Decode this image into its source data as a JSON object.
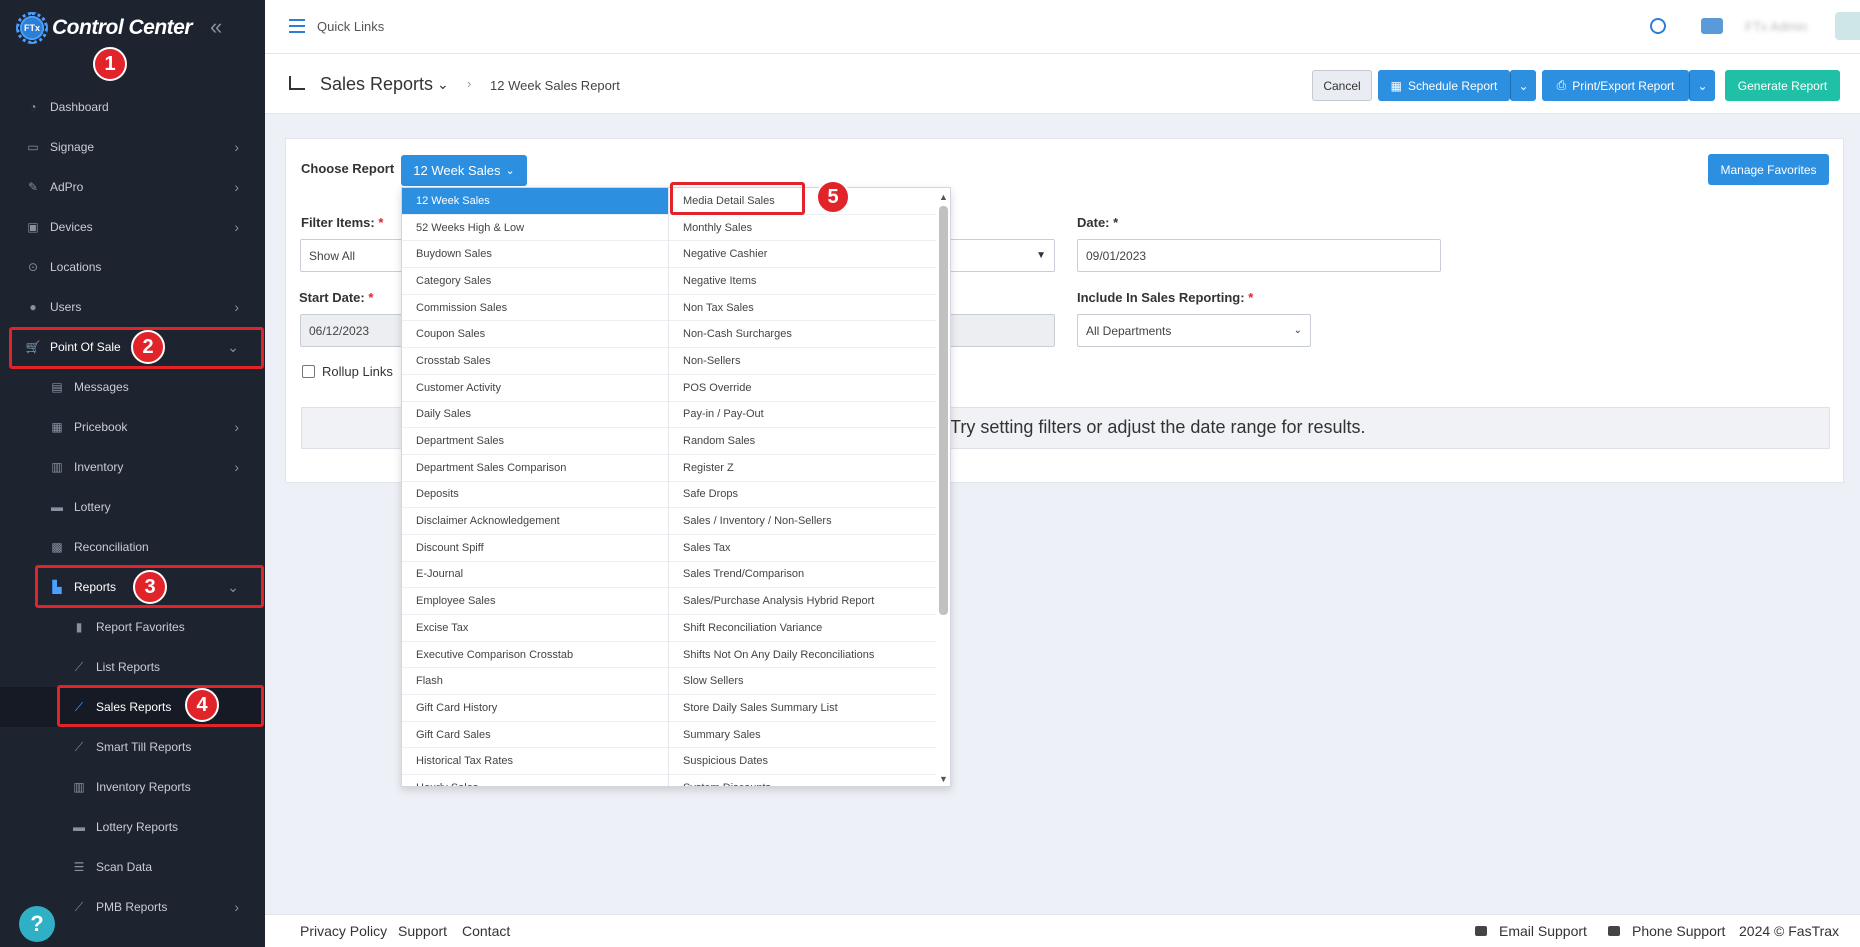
{
  "app": {
    "title": "Control Center",
    "logo_badge": "FTx"
  },
  "sidebar": {
    "items": [
      {
        "label": "Dashboard",
        "icon": "dashboard-icon"
      },
      {
        "label": "Signage",
        "icon": "monitor-icon"
      },
      {
        "label": "AdPro",
        "icon": "brush-icon"
      },
      {
        "label": "Devices",
        "icon": "devices-icon"
      },
      {
        "label": "Locations",
        "icon": "location-pin-icon"
      },
      {
        "label": "Users",
        "icon": "users-icon"
      },
      {
        "label": "Point Of Sale",
        "icon": "cart-icon"
      },
      {
        "label": "Messages",
        "icon": "message-icon"
      },
      {
        "label": "Pricebook",
        "icon": "calculator-icon"
      },
      {
        "label": "Inventory",
        "icon": "inventory-icon"
      },
      {
        "label": "Lottery",
        "icon": "ticket-icon"
      },
      {
        "label": "Reconciliation",
        "icon": "grid-icon"
      },
      {
        "label": "Reports",
        "icon": "bar-chart-icon"
      },
      {
        "label": "Report Favorites",
        "icon": "bookmark-icon"
      },
      {
        "label": "List Reports",
        "icon": "line-chart-icon"
      },
      {
        "label": "Sales Reports",
        "icon": "line-chart-icon"
      },
      {
        "label": "Smart Till Reports",
        "icon": "line-chart-icon"
      },
      {
        "label": "Inventory Reports",
        "icon": "inventory-icon"
      },
      {
        "label": "Lottery Reports",
        "icon": "ticket-icon"
      },
      {
        "label": "Scan Data",
        "icon": "list-icon"
      },
      {
        "label": "PMB Reports",
        "icon": "line-chart-icon"
      }
    ]
  },
  "annotations": [
    "1",
    "2",
    "3",
    "4",
    "5"
  ],
  "topbar": {
    "quick_links": "Quick Links",
    "user_name": "FTx Admin"
  },
  "header": {
    "title": "Sales Reports",
    "breadcrumb": "12 Week Sales Report",
    "cancel": "Cancel",
    "schedule": "Schedule Report",
    "print_export": "Print/Export Report",
    "generate": "Generate Report"
  },
  "form": {
    "choose_report_label": "Choose Report",
    "choose_report_value": "12 Week Sales",
    "manage_favorites": "Manage Favorites",
    "filter_items_label": "Filter Items:",
    "filter_items_value": "Show All",
    "date_label": "Date:",
    "date_value": "09/01/2023",
    "start_date_label": "Start Date:",
    "start_date_value": "06/12/2023",
    "include_label": "Include In Sales Reporting:",
    "include_value": "All Departments",
    "rollup_label": "Rollup Links",
    "required_mark": "*",
    "empty_message": "Try setting filters or adjust the date range for results."
  },
  "dropdown": {
    "left": [
      "12 Week Sales",
      "52 Weeks High & Low",
      "Buydown Sales",
      "Category Sales",
      "Commission Sales",
      "Coupon Sales",
      "Crosstab Sales",
      "Customer Activity",
      "Daily Sales",
      "Department Sales",
      "Department Sales Comparison",
      "Deposits",
      "Disclaimer Acknowledgement",
      "Discount Spiff",
      "E-Journal",
      "Employee Sales",
      "Excise Tax",
      "Executive Comparison Crosstab",
      "Flash",
      "Gift Card History",
      "Gift Card Sales",
      "Historical Tax Rates",
      "Hourly Sales"
    ],
    "right": [
      "Media Detail Sales",
      "Monthly Sales",
      "Negative Cashier",
      "Negative Items",
      "Non Tax Sales",
      "Non-Cash Surcharges",
      "Non-Sellers",
      "POS Override",
      "Pay-in / Pay-Out",
      "Random Sales",
      "Register Z",
      "Safe Drops",
      "Sales / Inventory / Non-Sellers",
      "Sales Tax",
      "Sales Trend/Comparison",
      "Sales/Purchase Analysis Hybrid Report",
      "Shift Reconciliation Variance",
      "Shifts Not On Any Daily Reconciliations",
      "Slow Sellers",
      "Store Daily Sales Summary List",
      "Summary Sales",
      "Suspicious Dates",
      "System Discounts"
    ]
  },
  "footer": {
    "privacy": "Privacy Policy",
    "support": "Support",
    "contact": "Contact",
    "email_support": "Email Support",
    "phone_support": "Phone Support",
    "copyright": "2024 © FasTrax"
  },
  "colors": {
    "sidebar_bg": "#1e2330",
    "accent": "#2d8fe0",
    "generate": "#1fc0a6",
    "annotation": "#e0242a"
  }
}
